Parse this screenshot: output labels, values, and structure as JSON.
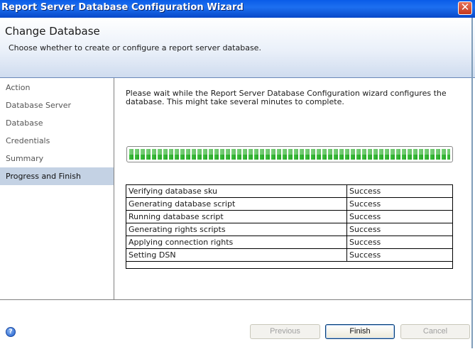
{
  "window": {
    "title": "Report Server Database Configuration Wizard",
    "close_symbol": "✕"
  },
  "header": {
    "title": "Change Database",
    "subtitle": "Choose whether to create or configure a report server database."
  },
  "sidebar": {
    "items": [
      {
        "label": "Action"
      },
      {
        "label": "Database Server"
      },
      {
        "label": "Database"
      },
      {
        "label": "Credentials"
      },
      {
        "label": "Summary"
      },
      {
        "label": "Progress and Finish",
        "active": true
      }
    ]
  },
  "main": {
    "info_text": "Please wait while the Report Server Database Configuration wizard configures the\ndatabase.  This might take several minutes to complete.",
    "progress": {
      "value_percent": 100,
      "color": "#3cc23c"
    },
    "steps": [
      {
        "task": "Verifying database sku",
        "status": "Success"
      },
      {
        "task": "Generating database script",
        "status": "Success"
      },
      {
        "task": "Running database script",
        "status": "Success"
      },
      {
        "task": "Generating rights scripts",
        "status": "Success"
      },
      {
        "task": "Applying connection rights",
        "status": "Success"
      },
      {
        "task": "Setting DSN",
        "status": "Success"
      }
    ]
  },
  "footer": {
    "help_icon": "help-icon",
    "previous_label": "Previous",
    "finish_label": "Finish",
    "cancel_label": "Cancel"
  },
  "colors": {
    "titlebar": "#0a5ce8",
    "active_nav": "#c4d2e4",
    "close": "#c4371e"
  }
}
